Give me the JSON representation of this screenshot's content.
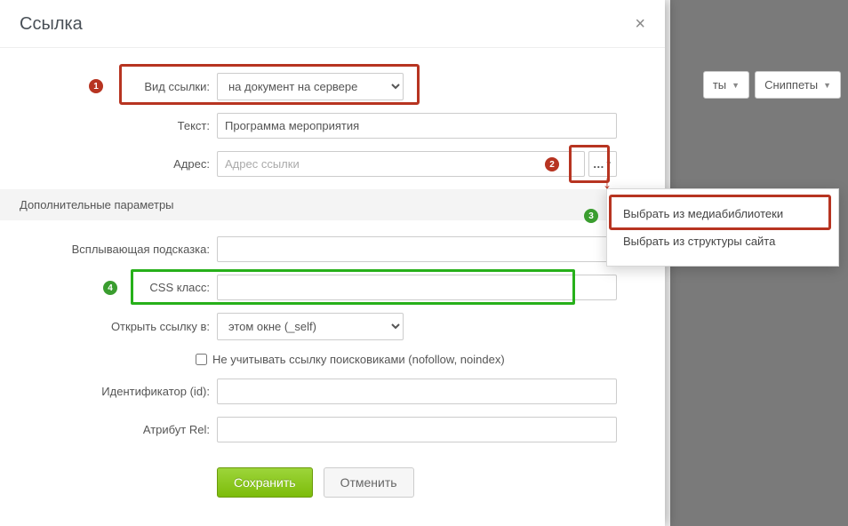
{
  "dialog": {
    "title": "Ссылка",
    "close_glyph": "×"
  },
  "fields": {
    "linktype": {
      "label": "Вид ссылки:",
      "value": "на документ на сервере"
    },
    "text": {
      "label": "Текст:",
      "value": "Программа мероприятия"
    },
    "address": {
      "label": "Адрес:",
      "placeholder": "Адрес ссылки"
    },
    "tooltip": {
      "label": "Всплывающая подсказка:"
    },
    "cssclass": {
      "label": "CSS класс:"
    },
    "target": {
      "label": "Открыть ссылку в:",
      "value": "этом окне (_self)"
    },
    "nofollow": {
      "label": "Не учитывать ссылку поисковиками (nofollow, noindex)"
    },
    "id": {
      "label": "Идентификатор (id):"
    },
    "rel": {
      "label": "Атрибут Rel:"
    }
  },
  "section_heading": "Дополнительные параметры",
  "browse_dots": "...",
  "buttons": {
    "save": "Сохранить",
    "cancel": "Отменить"
  },
  "popover": {
    "opt1": "Выбрать из медиабиблиотеки",
    "opt2": "Выбрать из структуры сайта"
  },
  "markers": {
    "m1": "1",
    "m2": "2",
    "m3": "3",
    "m4": "4"
  },
  "bg": {
    "components_suffix": "ты",
    "snippets": "Сниппеты"
  }
}
